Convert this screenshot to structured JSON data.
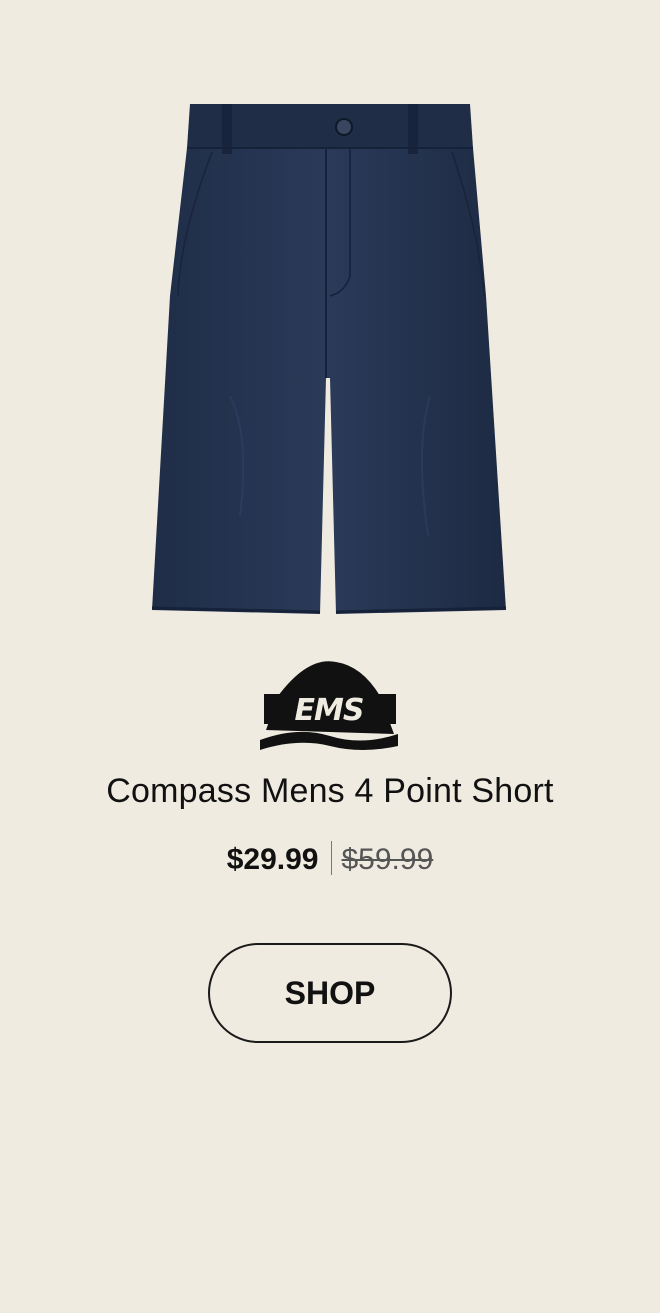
{
  "product": {
    "image_icon": "navy-shorts-image",
    "brand_logo_icon": "ems-logo",
    "brand_logo_text": "EMS",
    "title": "Compass Mens 4 Point Short",
    "sale_price": "$29.99",
    "original_price": "$59.99"
  },
  "cta": {
    "shop_label": "SHOP"
  },
  "colors": {
    "background": "#f0ebe0",
    "shorts_navy": "#243450",
    "text": "#111111"
  }
}
